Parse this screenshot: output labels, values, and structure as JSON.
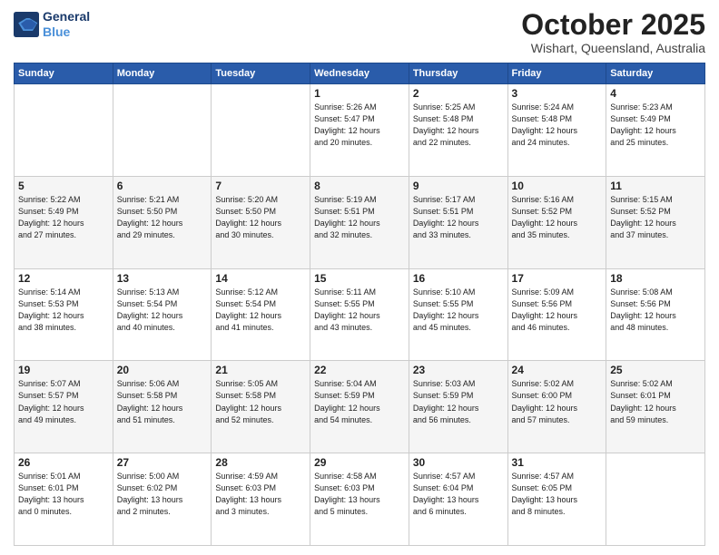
{
  "logo": {
    "line1": "General",
    "line2": "Blue"
  },
  "header": {
    "month": "October 2025",
    "location": "Wishart, Queensland, Australia"
  },
  "weekdays": [
    "Sunday",
    "Monday",
    "Tuesday",
    "Wednesday",
    "Thursday",
    "Friday",
    "Saturday"
  ],
  "weeks": [
    [
      {
        "day": "",
        "info": ""
      },
      {
        "day": "",
        "info": ""
      },
      {
        "day": "",
        "info": ""
      },
      {
        "day": "1",
        "info": "Sunrise: 5:26 AM\nSunset: 5:47 PM\nDaylight: 12 hours\nand 20 minutes."
      },
      {
        "day": "2",
        "info": "Sunrise: 5:25 AM\nSunset: 5:48 PM\nDaylight: 12 hours\nand 22 minutes."
      },
      {
        "day": "3",
        "info": "Sunrise: 5:24 AM\nSunset: 5:48 PM\nDaylight: 12 hours\nand 24 minutes."
      },
      {
        "day": "4",
        "info": "Sunrise: 5:23 AM\nSunset: 5:49 PM\nDaylight: 12 hours\nand 25 minutes."
      }
    ],
    [
      {
        "day": "5",
        "info": "Sunrise: 5:22 AM\nSunset: 5:49 PM\nDaylight: 12 hours\nand 27 minutes."
      },
      {
        "day": "6",
        "info": "Sunrise: 5:21 AM\nSunset: 5:50 PM\nDaylight: 12 hours\nand 29 minutes."
      },
      {
        "day": "7",
        "info": "Sunrise: 5:20 AM\nSunset: 5:50 PM\nDaylight: 12 hours\nand 30 minutes."
      },
      {
        "day": "8",
        "info": "Sunrise: 5:19 AM\nSunset: 5:51 PM\nDaylight: 12 hours\nand 32 minutes."
      },
      {
        "day": "9",
        "info": "Sunrise: 5:17 AM\nSunset: 5:51 PM\nDaylight: 12 hours\nand 33 minutes."
      },
      {
        "day": "10",
        "info": "Sunrise: 5:16 AM\nSunset: 5:52 PM\nDaylight: 12 hours\nand 35 minutes."
      },
      {
        "day": "11",
        "info": "Sunrise: 5:15 AM\nSunset: 5:52 PM\nDaylight: 12 hours\nand 37 minutes."
      }
    ],
    [
      {
        "day": "12",
        "info": "Sunrise: 5:14 AM\nSunset: 5:53 PM\nDaylight: 12 hours\nand 38 minutes."
      },
      {
        "day": "13",
        "info": "Sunrise: 5:13 AM\nSunset: 5:54 PM\nDaylight: 12 hours\nand 40 minutes."
      },
      {
        "day": "14",
        "info": "Sunrise: 5:12 AM\nSunset: 5:54 PM\nDaylight: 12 hours\nand 41 minutes."
      },
      {
        "day": "15",
        "info": "Sunrise: 5:11 AM\nSunset: 5:55 PM\nDaylight: 12 hours\nand 43 minutes."
      },
      {
        "day": "16",
        "info": "Sunrise: 5:10 AM\nSunset: 5:55 PM\nDaylight: 12 hours\nand 45 minutes."
      },
      {
        "day": "17",
        "info": "Sunrise: 5:09 AM\nSunset: 5:56 PM\nDaylight: 12 hours\nand 46 minutes."
      },
      {
        "day": "18",
        "info": "Sunrise: 5:08 AM\nSunset: 5:56 PM\nDaylight: 12 hours\nand 48 minutes."
      }
    ],
    [
      {
        "day": "19",
        "info": "Sunrise: 5:07 AM\nSunset: 5:57 PM\nDaylight: 12 hours\nand 49 minutes."
      },
      {
        "day": "20",
        "info": "Sunrise: 5:06 AM\nSunset: 5:58 PM\nDaylight: 12 hours\nand 51 minutes."
      },
      {
        "day": "21",
        "info": "Sunrise: 5:05 AM\nSunset: 5:58 PM\nDaylight: 12 hours\nand 52 minutes."
      },
      {
        "day": "22",
        "info": "Sunrise: 5:04 AM\nSunset: 5:59 PM\nDaylight: 12 hours\nand 54 minutes."
      },
      {
        "day": "23",
        "info": "Sunrise: 5:03 AM\nSunset: 5:59 PM\nDaylight: 12 hours\nand 56 minutes."
      },
      {
        "day": "24",
        "info": "Sunrise: 5:02 AM\nSunset: 6:00 PM\nDaylight: 12 hours\nand 57 minutes."
      },
      {
        "day": "25",
        "info": "Sunrise: 5:02 AM\nSunset: 6:01 PM\nDaylight: 12 hours\nand 59 minutes."
      }
    ],
    [
      {
        "day": "26",
        "info": "Sunrise: 5:01 AM\nSunset: 6:01 PM\nDaylight: 13 hours\nand 0 minutes."
      },
      {
        "day": "27",
        "info": "Sunrise: 5:00 AM\nSunset: 6:02 PM\nDaylight: 13 hours\nand 2 minutes."
      },
      {
        "day": "28",
        "info": "Sunrise: 4:59 AM\nSunset: 6:03 PM\nDaylight: 13 hours\nand 3 minutes."
      },
      {
        "day": "29",
        "info": "Sunrise: 4:58 AM\nSunset: 6:03 PM\nDaylight: 13 hours\nand 5 minutes."
      },
      {
        "day": "30",
        "info": "Sunrise: 4:57 AM\nSunset: 6:04 PM\nDaylight: 13 hours\nand 6 minutes."
      },
      {
        "day": "31",
        "info": "Sunrise: 4:57 AM\nSunset: 6:05 PM\nDaylight: 13 hours\nand 8 minutes."
      },
      {
        "day": "",
        "info": ""
      }
    ]
  ]
}
